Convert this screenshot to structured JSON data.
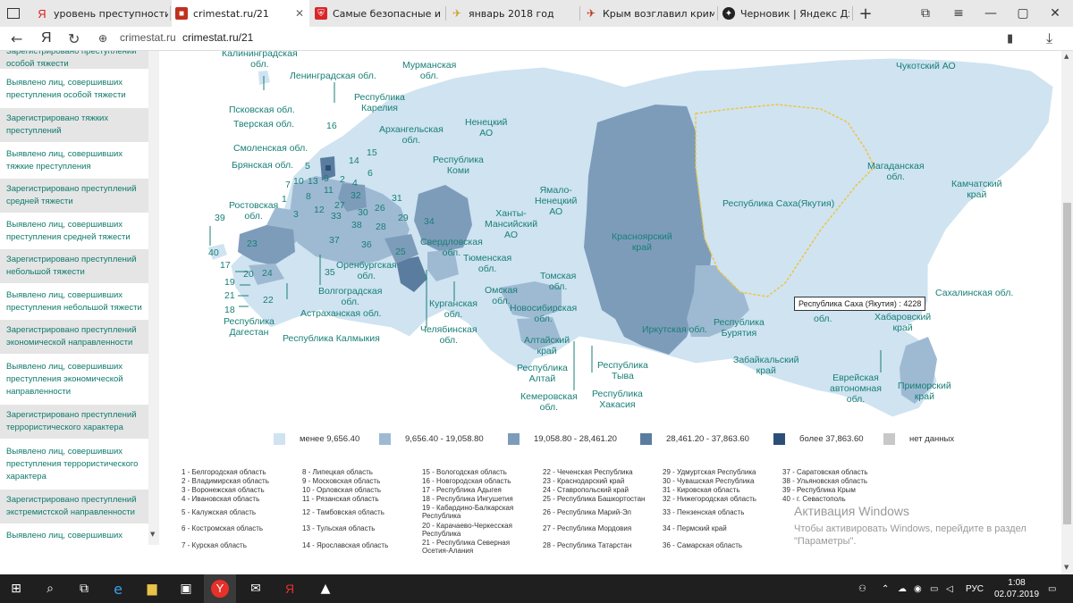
{
  "tabs": [
    {
      "title": "уровень преступности в к"
    },
    {
      "title": "crimestat.ru/21"
    },
    {
      "title": "Самые безопасные и сам"
    },
    {
      "title": "январь 2018 год"
    },
    {
      "title": "Крым возглавил кримина"
    },
    {
      "title": "Черновик | Яндекс Дзен"
    }
  ],
  "addressbar": {
    "site": "crimestat.ru",
    "url": "crimestat.ru/21",
    "nav_label": "Я"
  },
  "sidebar": {
    "items": [
      {
        "label": "Зарегистрировано преступлений особой тяжести"
      },
      {
        "label": "Выявлено лиц, совершивших преступления особой тяжести"
      },
      {
        "label": "Зарегистрировано тяжких преступлений"
      },
      {
        "label": "Выявлено лиц, совершивших тяжкие преступления"
      },
      {
        "label": "Зарегистрировано преступлений средней тяжести"
      },
      {
        "label": "Выявлено лиц, совершивших преступления средней тяжести"
      },
      {
        "label": "Зарегистрировано преступлений небольшой тяжести"
      },
      {
        "label": "Выявлено лиц, совершивших преступления небольшой тяжести"
      },
      {
        "label": "Зарегистрировано преступлений экономической направленности"
      },
      {
        "label": "Выявлено лиц, совершивших преступления экономической направленности"
      },
      {
        "label": "Зарегистрировано преступлений террористического характера"
      },
      {
        "label": "Выявлено лиц, совершивших преступления террористического характера"
      },
      {
        "label": "Зарегистрировано преступлений экстремистской направленности"
      },
      {
        "label": "Выявлено лиц, совершивших"
      }
    ]
  },
  "map": {
    "labels": [
      {
        "t": "Калининградская\nобл."
      },
      {
        "t": "Ленинградская обл."
      },
      {
        "t": "Мурманская\nобл."
      },
      {
        "t": "Республика\nКарелия"
      },
      {
        "t": "Псковская обл."
      },
      {
        "t": "Тверская обл."
      },
      {
        "t": "Архангельская\nобл."
      },
      {
        "t": "Ненецкий\nАО"
      },
      {
        "t": "Смоленская обл."
      },
      {
        "t": "Брянская обл."
      },
      {
        "t": "Республика\nКоми"
      },
      {
        "t": "Ростовская\nобл."
      },
      {
        "t": "Ямало-\nНенецкий\nАО"
      },
      {
        "t": "Ханты-\nМансийский\nАО"
      },
      {
        "t": "Свердловская\nобл."
      },
      {
        "t": "Тюменская\nобл."
      },
      {
        "t": "Оренбургская\nобл."
      },
      {
        "t": "Волгоградская\nобл."
      },
      {
        "t": "Астраханская обл."
      },
      {
        "t": "Республика\nДагестан"
      },
      {
        "t": "Республика Калмыкия"
      },
      {
        "t": "Челябинская\nобл."
      },
      {
        "t": "Курганская\nобл."
      },
      {
        "t": "Омская\nобл."
      },
      {
        "t": "Новосибирская\nобл."
      },
      {
        "t": "Томская\nобл."
      },
      {
        "t": "Алтайский\nкрай"
      },
      {
        "t": "Республика\nАлтай"
      },
      {
        "t": "Кемеровская\nобл."
      },
      {
        "t": "Республика\nТыва"
      },
      {
        "t": "Республика\nХакасия"
      },
      {
        "t": "Красноярский\nкрай"
      },
      {
        "t": "Иркутская обл."
      },
      {
        "t": "Республика\nБурятия"
      },
      {
        "t": "Забайкальский\nкрай"
      },
      {
        "t": "Республика Саха(Якутия)"
      },
      {
        "t": "Чукотский АО"
      },
      {
        "t": "Магаданская\nобл."
      },
      {
        "t": "Камчатский\nкрай"
      },
      {
        "t": "Сахалинская обл."
      },
      {
        "t": "Хабаровский\nкрай"
      },
      {
        "t": "Еврейская\nавтономная\nобл."
      },
      {
        "t": "Приморский\nкрай"
      },
      {
        "t": "обл."
      }
    ],
    "numbers": [
      "16",
      "15",
      "14",
      "5",
      "6",
      "2",
      "4",
      "10",
      "13",
      "7",
      "9",
      "11",
      "8",
      "1",
      "12",
      "32",
      "27",
      "31",
      "26",
      "30",
      "33",
      "29",
      "34",
      "28",
      "38",
      "37",
      "36",
      "25",
      "3",
      "23",
      "35",
      "39",
      "17",
      "40",
      "20",
      "24",
      "19",
      "21",
      "22",
      "18"
    ],
    "tooltip": "Республика Саха (Якутия) : 4228",
    "colors": {
      "lvl1": "#cfe3f1",
      "lvl2": "#9ebad3",
      "lvl3": "#7d9cba",
      "lvl4": "#5a7d9f",
      "lvl5": "#2c4f78",
      "nodata": "#c8c8c8",
      "label": "#187f76"
    }
  },
  "legend": [
    {
      "label": "менее 9,656.40",
      "color": "#cfe3f1"
    },
    {
      "label": "9,656.40 - 19,058.80",
      "color": "#9ebad3"
    },
    {
      "label": "19,058.80 - 28,461.20",
      "color": "#7d9cba"
    },
    {
      "label": "28,461.20 - 37,863.60",
      "color": "#5a7d9f"
    },
    {
      "label": "более 37,863.60",
      "color": "#2c4f78"
    },
    {
      "label": "нет данных",
      "color": "#c8c8c8"
    }
  ],
  "key": [
    [
      "1 - Белгородская область",
      "2 - Владимирская область",
      "3 - Воронежская область",
      "4 - Ивановская область",
      "5 - Калужская область",
      "6 - Костромская область",
      "7 - Курская область"
    ],
    [
      "8 - Липецкая область",
      "9 - Московская область",
      "10 - Орловская область",
      "11 - Рязанская область",
      "12 - Тамбовская область",
      "13 - Тульская область",
      "14 - Ярославская область"
    ],
    [
      "15 - Вологодская область",
      "16 - Новгородская область",
      "17 - Республика Адыгея",
      "18 - Республика Ингушетия",
      "19 - Кабардино-Балкарская Республика",
      "20 - Карачаево-Черкесская Республика",
      "21 - Республика Северная Осетия-Алания"
    ],
    [
      "22 - Чеченская Республика",
      "23 - Краснодарский край",
      "24 - Ставропольский край",
      "25 - Республика Башкортостан",
      "26 - Республика Марий-Эл",
      "27 - Республика Мордовия",
      "28 - Республика Татарстан"
    ],
    [
      "29 - Удмуртская Республика",
      "30 - Чувашская Республика",
      "31 - Кировская область",
      "32 - Нижегородская область",
      "33 - Пензенская область",
      "34 - Пермский край",
      "36 - Самарская область"
    ],
    [
      "37 - Саратовская область",
      "38 - Ульяновская область",
      "39 - Республика Крым",
      "40 - г. Севастополь"
    ]
  ],
  "watermark": {
    "title": "Активация Windows",
    "text": "Чтобы активировать Windows, перейдите в раздел \"Параметры\"."
  },
  "tray": {
    "lang": "РУС",
    "time": "1:08",
    "date": "02.07.2019"
  }
}
